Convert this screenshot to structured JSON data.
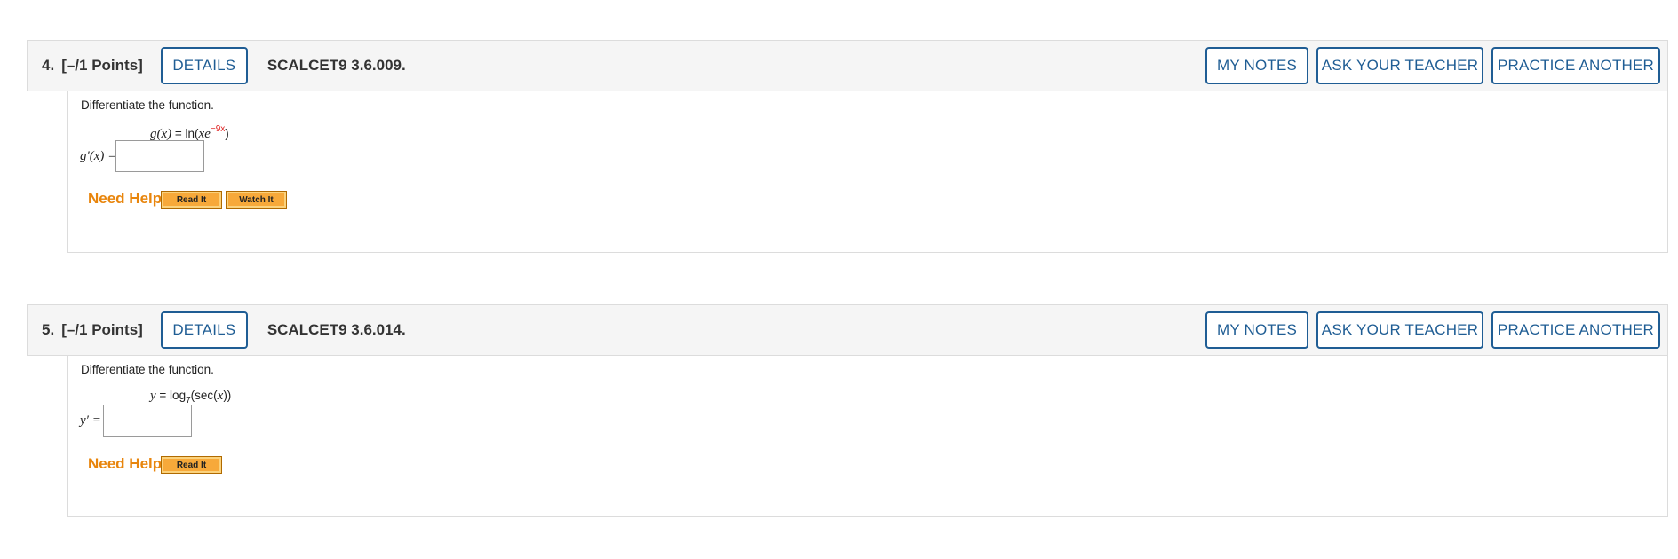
{
  "questions": [
    {
      "number": "4.",
      "points": "[–/1 Points]",
      "details_label": "DETAILS",
      "code": "SCALCET9 3.6.009.",
      "my_notes_label": "MY NOTES",
      "ask_teacher_label": "ASK YOUR TEACHER",
      "practice_label": "PRACTICE ANOTHER",
      "prompt": "Differentiate the function.",
      "equation": {
        "lhs": "g(x)",
        "eq": " = ln(",
        "var": "xe",
        "superscript": "−9x",
        "close": ")"
      },
      "answer_label": "g′(x) =",
      "answer_value": "",
      "need_help": "Need Help?",
      "help_buttons": [
        "Read It",
        "Watch It"
      ]
    },
    {
      "number": "5.",
      "points": "[–/1 Points]",
      "details_label": "DETAILS",
      "code": "SCALCET9 3.6.014.",
      "my_notes_label": "MY NOTES",
      "ask_teacher_label": "ASK YOUR TEACHER",
      "practice_label": "PRACTICE ANOTHER",
      "prompt": "Differentiate the function.",
      "equation": {
        "lhs": "y",
        "eq": " = log",
        "subscript": "7",
        "rest": "(sec(",
        "var": "x",
        "close": "))"
      },
      "answer_label": "y′ =",
      "answer_value": "",
      "need_help": "Need Help?",
      "help_buttons": [
        "Read It"
      ]
    }
  ]
}
